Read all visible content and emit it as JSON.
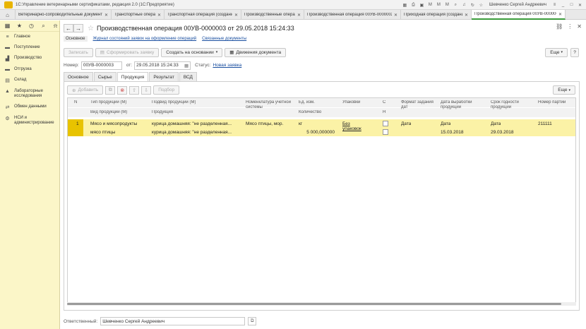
{
  "window": {
    "app_title": "1С:Управление ветеринарными сертификатами, редакция 2.0 (1С:Предприятие)",
    "user": "Шевченко Сергей Андреевич"
  },
  "tabs": [
    {
      "label": "Ветеринарно-сопроводительные документы (...",
      "active": false
    },
    {
      "label": "Транспортные операции",
      "active": false
    },
    {
      "label": "Транспортная операция (создание) *",
      "active": false
    },
    {
      "label": "Производственные операции",
      "active": false
    },
    {
      "label": "Производственная операция 00УВ-0000002 о...",
      "active": false
    },
    {
      "label": "Приходная операция (создание) *",
      "active": false
    },
    {
      "label": "Производственная операция 00УВ-0000003 о...",
      "active": true
    }
  ],
  "sidebar": {
    "items": [
      {
        "label": "Главное",
        "icon": "menu-icon"
      },
      {
        "label": "Поступление",
        "icon": "truck-icon"
      },
      {
        "label": "Производство",
        "icon": "factory-icon"
      },
      {
        "label": "Отгрузка",
        "icon": "truck-icon"
      },
      {
        "label": "Склад",
        "icon": "warehouse-icon"
      },
      {
        "label": "Лабораторные исследования",
        "icon": "flask-icon"
      },
      {
        "label": "Обмен данными",
        "icon": "exchange-icon"
      },
      {
        "label": "НСИ и администрирование",
        "icon": "gear-icon"
      }
    ]
  },
  "doc": {
    "title": "Производственная операция 00УВ-0000003 от 29.05.2018 15:24:33",
    "links": {
      "current": "Основное",
      "journal": "Журнал состояний заявок на оформление операций",
      "related": "Связанные документы"
    },
    "toolbar": {
      "record": "Записать",
      "form_request": "Сформировать заявку",
      "create_based": "Создать на основании",
      "movements": "Движения документа",
      "more": "Еще",
      "help": "?"
    },
    "fields": {
      "number_label": "Номер:",
      "number_value": "00УВ-0000003",
      "date_label": "от:",
      "date_value": "29.05.2018 15:24:33",
      "status_label": "Статус:",
      "status_value": "Новая заявка"
    },
    "subtabs": [
      "Основное",
      "Сырье",
      "Продукция",
      "Результат",
      "ВСД"
    ],
    "active_subtab": "Продукция",
    "panel_toolbar": {
      "add": "Добавить",
      "selection": "Подбор",
      "more": "Еще"
    },
    "table": {
      "headers_top": [
        "N",
        "Тип продукции (М)",
        "Подвид продукции (М)",
        "Номенклатура учетной системы",
        "Ед. изм.",
        "Упаковки",
        "С",
        "Формат задания дат",
        "Дата выработки продукции",
        "Срок годности продукции",
        "Номер партии"
      ],
      "headers_bottom": [
        "Вид продукции (М)",
        "Продукция",
        "Количество",
        "Н"
      ],
      "rows": [
        {
          "n": "1",
          "type": "Мясо и мясопродукты",
          "kind": "мясо птицы",
          "subkind": "курица домашняя: \"не разделенная...",
          "product": "курица домашняя: \"не разделенная...",
          "nomenclature": "Мясо птицы, мор.",
          "unit": "кг",
          "quantity": "5 000,000000",
          "packaging": "Без упаковок",
          "date_format_1": "Дата",
          "date_format_2": "Дата",
          "prod_date": "15.03.2018",
          "expiry_format": "Дата",
          "expiry_date": "29.03.2018",
          "batch": "211111"
        }
      ]
    },
    "footer": {
      "responsible_label": "Ответственный:",
      "responsible_value": "Шевченко Сергей Андреевич"
    }
  }
}
